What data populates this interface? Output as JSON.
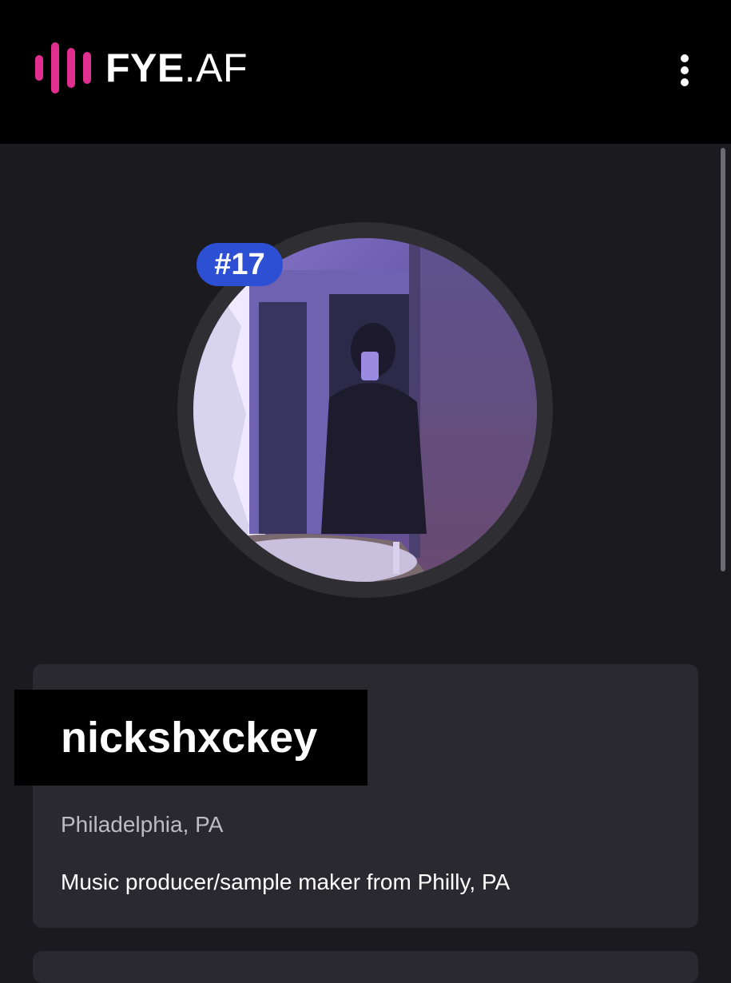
{
  "header": {
    "brand_strong": "FYE",
    "brand_light": ".AF",
    "menu_icon": "more-vertical-icon"
  },
  "profile": {
    "rank": "#17",
    "username": "nickshxckey",
    "location": "Philadelphia, PA",
    "bio": "Music producer/sample maker from Philly, PA"
  },
  "colors": {
    "brand_pink": "#e02f8f",
    "rank_badge": "#2d4fd4",
    "background": "#1b1a1f",
    "card": "#2a292f"
  }
}
